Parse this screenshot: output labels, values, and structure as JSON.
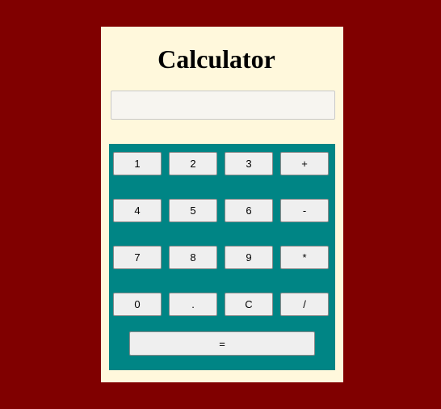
{
  "app": {
    "title": "Calculator"
  },
  "display": {
    "value": "",
    "placeholder": ""
  },
  "keys": {
    "k1": "1",
    "k2": "2",
    "k3": "3",
    "plus": "+",
    "k4": "4",
    "k5": "5",
    "k6": "6",
    "minus": "-",
    "k7": "7",
    "k8": "8",
    "k9": "9",
    "multiply": "*",
    "k0": "0",
    "decimal": ".",
    "clear": "C",
    "divide": "/",
    "equals": "="
  },
  "colors": {
    "page_background": "#800000",
    "card_background": "#fff8dc",
    "keypad_background": "#008585",
    "key_background": "#efefef"
  }
}
